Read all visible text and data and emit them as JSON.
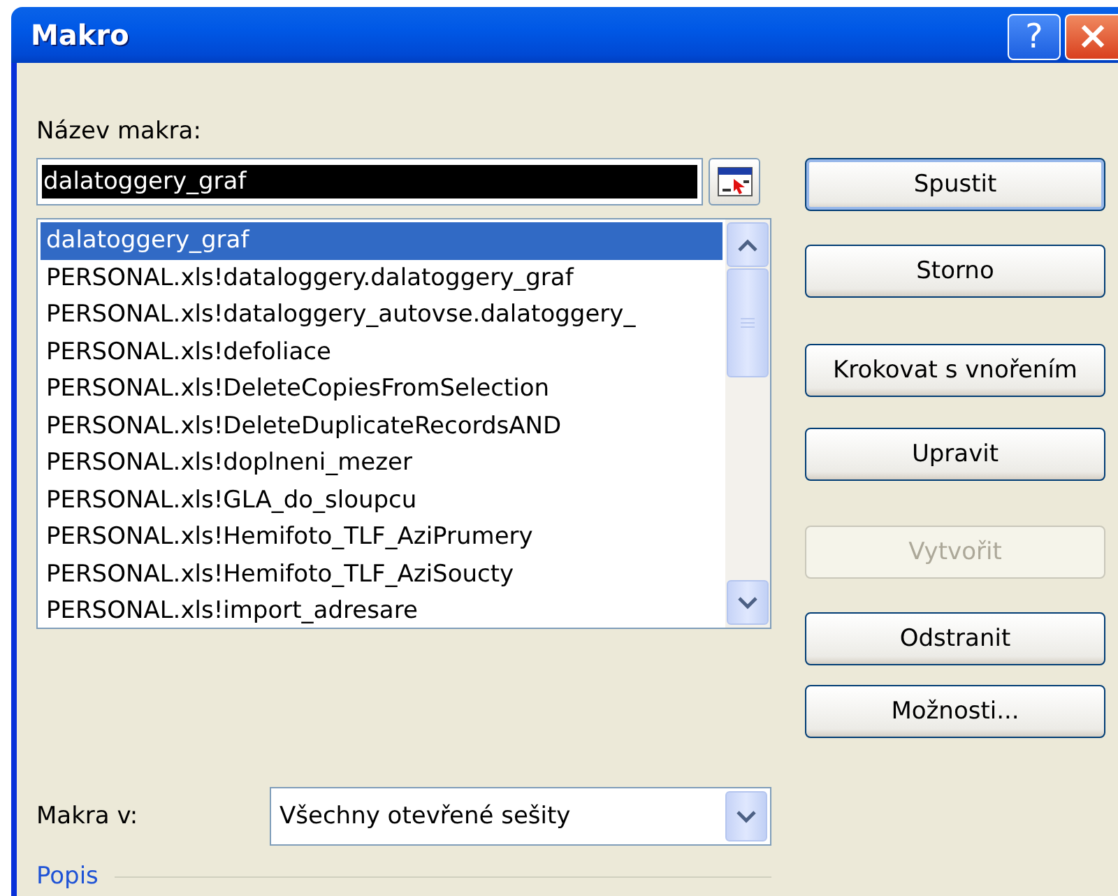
{
  "window": {
    "title": "Makro",
    "title_buttons": [
      {
        "kind": "help",
        "label": "?"
      },
      {
        "kind": "close"
      }
    ]
  },
  "macro_name": {
    "label": "Název makra:",
    "value": "dalatoggery_graf",
    "selected": true
  },
  "macro_list": {
    "items": [
      {
        "label": "dalatoggery_graf",
        "selected": true
      },
      {
        "label": "PERSONAL.xls!dataloggery.dalatoggery_graf",
        "selected": false
      },
      {
        "label": "PERSONAL.xls!dataloggery_autovse.dalatoggery_",
        "selected": false
      },
      {
        "label": "PERSONAL.xls!defoliace",
        "selected": false
      },
      {
        "label": "PERSONAL.xls!DeleteCopiesFromSelection",
        "selected": false
      },
      {
        "label": "PERSONAL.xls!DeleteDuplicateRecordsAND",
        "selected": false
      },
      {
        "label": "PERSONAL.xls!doplneni_mezer",
        "selected": false
      },
      {
        "label": "PERSONAL.xls!GLA_do_sloupcu",
        "selected": false
      },
      {
        "label": "PERSONAL.xls!Hemifoto_TLF_AziPrumery",
        "selected": false
      },
      {
        "label": "PERSONAL.xls!Hemifoto_TLF_AziSoucty",
        "selected": false
      },
      {
        "label": "PERSONAL.xls!import_adresare",
        "selected": false
      }
    ]
  },
  "buttons": [
    {
      "label": "Spustit",
      "default": true,
      "disabled": false
    },
    {
      "label": "Storno",
      "default": false,
      "disabled": false
    },
    {
      "label": "Krokovat s vnořením",
      "default": false,
      "disabled": false
    },
    {
      "label": "Upravit",
      "default": false,
      "disabled": false
    },
    {
      "label": "Vytvořit",
      "default": false,
      "disabled": true
    },
    {
      "label": "Odstranit",
      "default": false,
      "disabled": false
    },
    {
      "label": "Možnosti...",
      "default": false,
      "disabled": false
    }
  ],
  "macros_in": {
    "label": "Makra v:",
    "value": "Všechny otevřené sešity"
  },
  "description": {
    "label": "Popis"
  }
}
